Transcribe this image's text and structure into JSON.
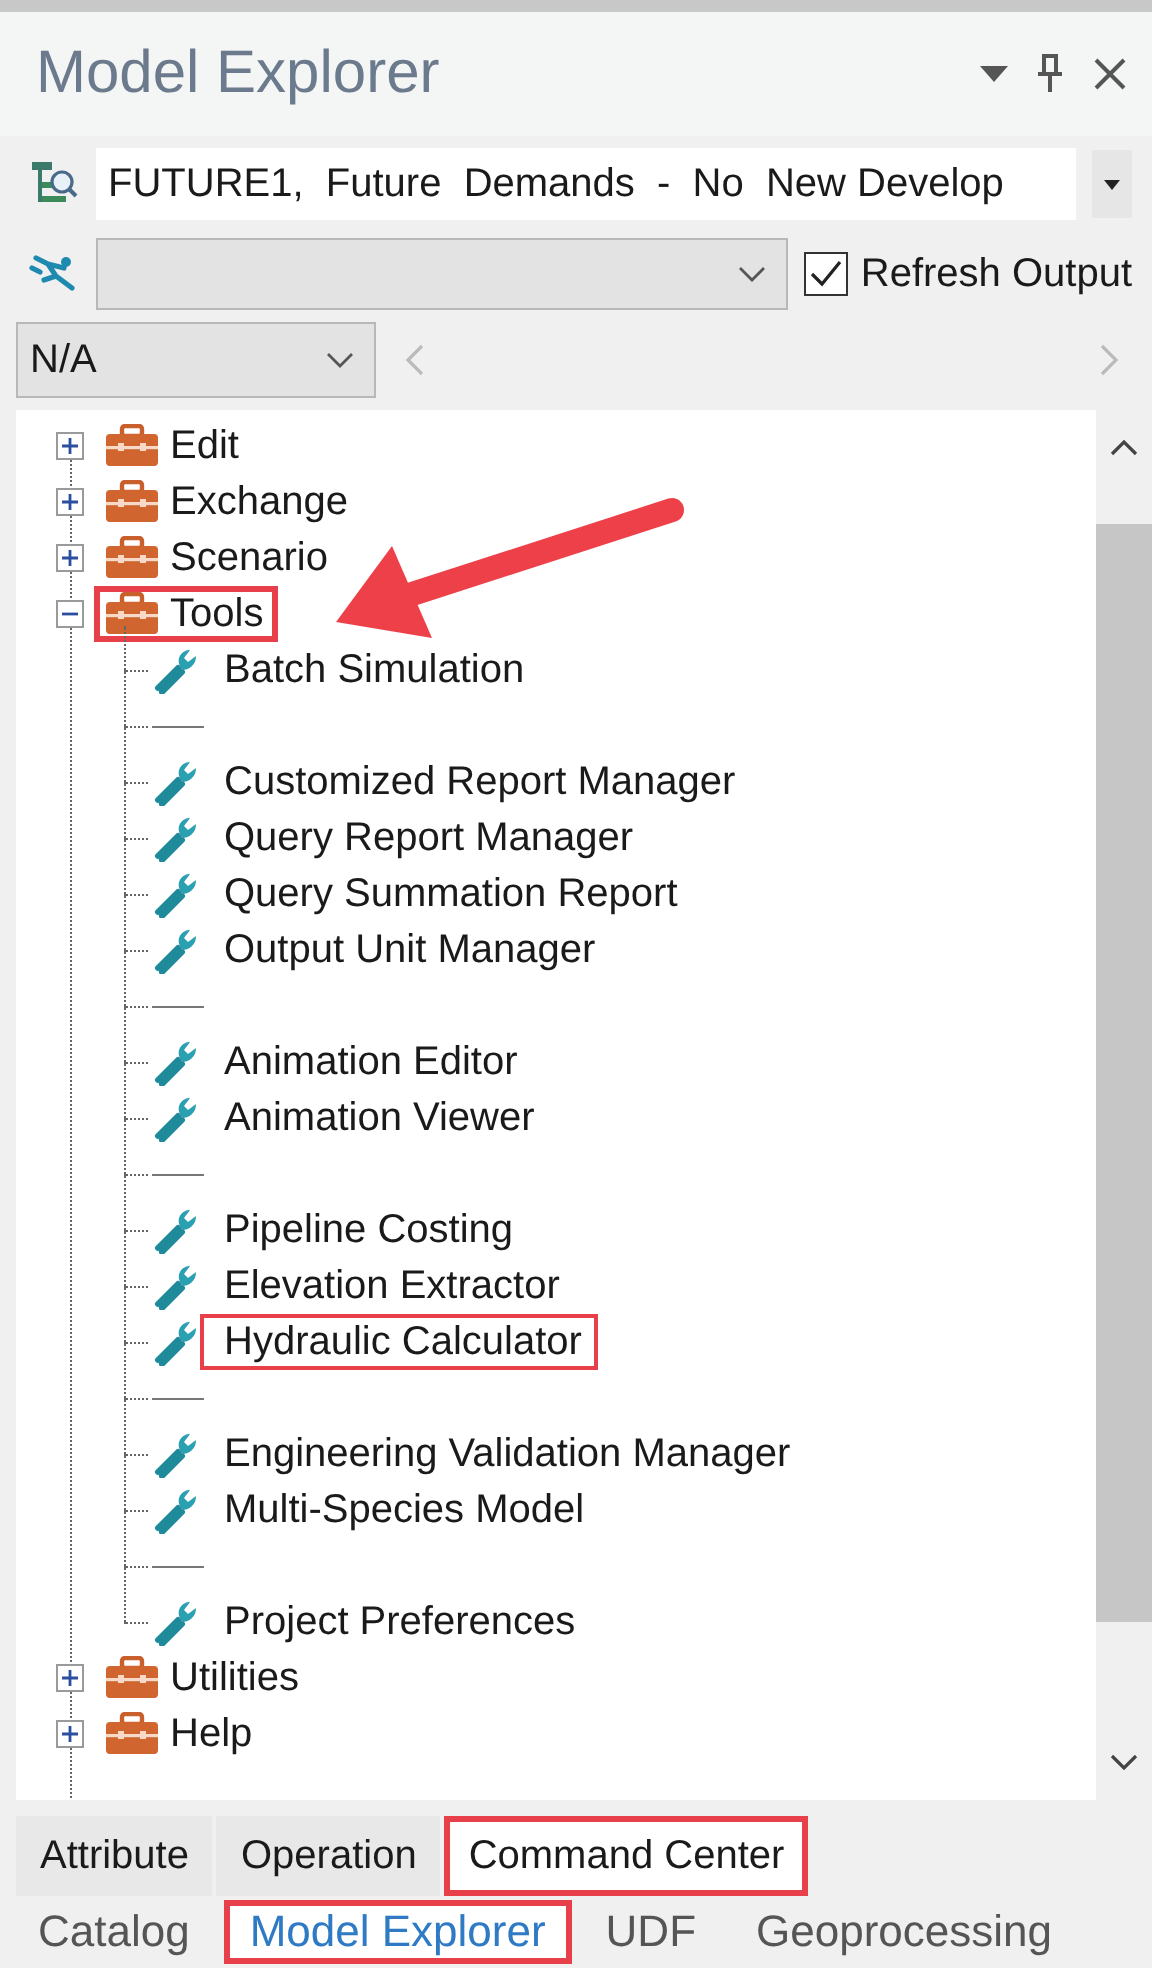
{
  "panel": {
    "title": "Model Explorer"
  },
  "scenario": {
    "value": "FUTURE1,  Future  Demands  -  No  New Develop"
  },
  "run_selector": {
    "disabled": true
  },
  "refresh_output": {
    "label": "Refresh Output",
    "checked": true
  },
  "filter": {
    "value": "N/A"
  },
  "tree": [
    {
      "kind": "toolbox",
      "label": "Edit",
      "expanded": false,
      "highlighted": false,
      "arrow": false
    },
    {
      "kind": "toolbox",
      "label": "Exchange",
      "expanded": false,
      "highlighted": false,
      "arrow": false
    },
    {
      "kind": "toolbox",
      "label": "Scenario",
      "expanded": false,
      "highlighted": false,
      "arrow": false
    },
    {
      "kind": "toolbox",
      "label": "Tools",
      "expanded": true,
      "highlighted": true,
      "arrow": true,
      "children": [
        {
          "kind": "tool",
          "label": "Batch Simulation",
          "highlighted": false
        },
        {
          "kind": "separator"
        },
        {
          "kind": "tool",
          "label": "Customized Report Manager",
          "highlighted": false
        },
        {
          "kind": "tool",
          "label": "Query Report Manager",
          "highlighted": false
        },
        {
          "kind": "tool",
          "label": "Query Summation Report",
          "highlighted": false
        },
        {
          "kind": "tool",
          "label": "Output Unit Manager",
          "highlighted": false
        },
        {
          "kind": "separator"
        },
        {
          "kind": "tool",
          "label": "Animation Editor",
          "highlighted": false
        },
        {
          "kind": "tool",
          "label": "Animation Viewer",
          "highlighted": false
        },
        {
          "kind": "separator"
        },
        {
          "kind": "tool",
          "label": "Pipeline Costing",
          "highlighted": false
        },
        {
          "kind": "tool",
          "label": "Elevation Extractor",
          "highlighted": false
        },
        {
          "kind": "tool",
          "label": "Hydraulic Calculator",
          "highlighted": true
        },
        {
          "kind": "separator"
        },
        {
          "kind": "tool",
          "label": "Engineering Validation Manager",
          "highlighted": false
        },
        {
          "kind": "tool",
          "label": "Multi-Species Model",
          "highlighted": false
        },
        {
          "kind": "separator"
        },
        {
          "kind": "tool",
          "label": "Project Preferences",
          "highlighted": false
        }
      ]
    },
    {
      "kind": "toolbox",
      "label": "Utilities",
      "expanded": false,
      "highlighted": false,
      "arrow": false
    },
    {
      "kind": "toolbox",
      "label": "Help",
      "expanded": false,
      "highlighted": false,
      "arrow": false
    }
  ],
  "tabs_top": [
    {
      "label": "Attribute",
      "selected": false,
      "highlighted": false
    },
    {
      "label": "Operation",
      "selected": false,
      "highlighted": false
    },
    {
      "label": "Command Center",
      "selected": true,
      "highlighted": true
    }
  ],
  "tabs_bottom": [
    {
      "label": "Catalog",
      "selected": false,
      "highlighted": false
    },
    {
      "label": "Model Explorer",
      "selected": true,
      "highlighted": true
    },
    {
      "label": "UDF",
      "selected": false,
      "highlighted": false
    },
    {
      "label": "Geoprocessing",
      "selected": false,
      "highlighted": false
    }
  ]
}
